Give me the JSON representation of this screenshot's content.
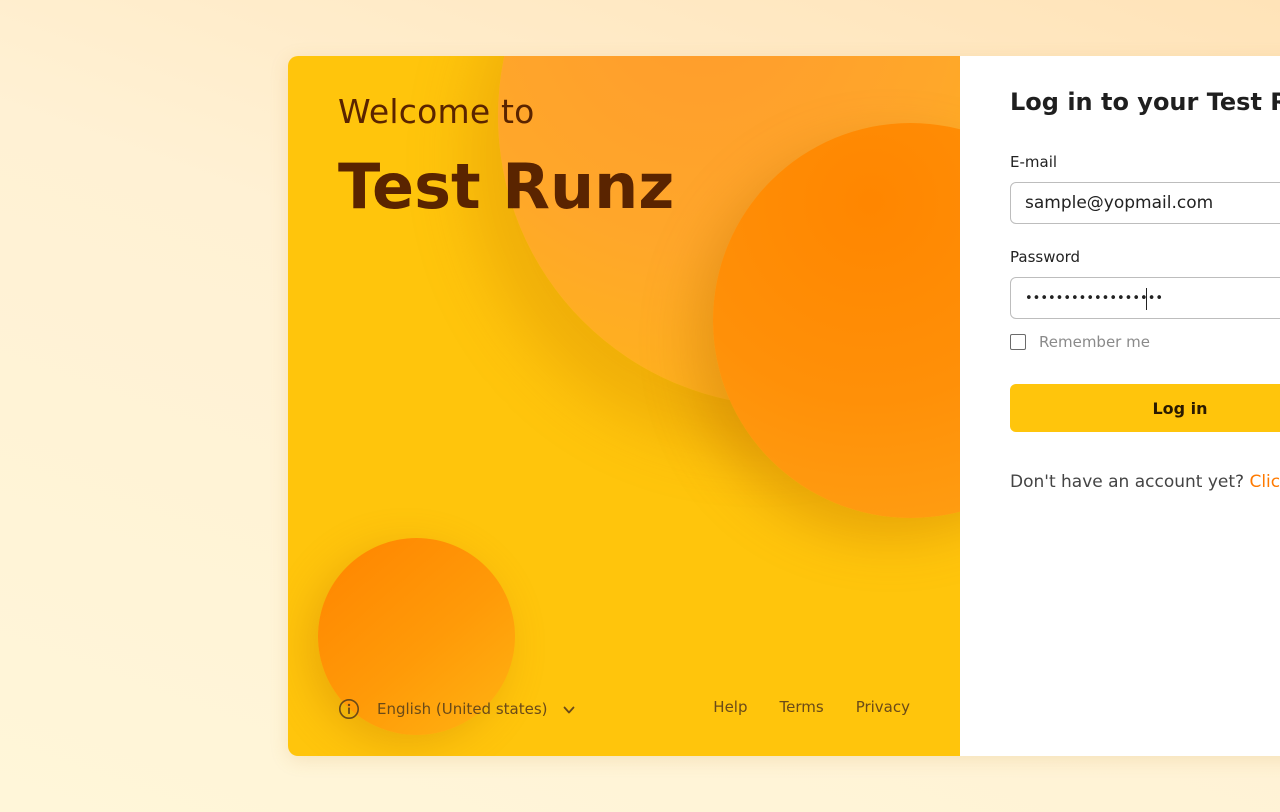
{
  "hero": {
    "welcome": "Welcome to",
    "brand": "Test Runz",
    "colors": {
      "background": "#ffc50c",
      "accent": "#ff8600",
      "text": "#5a2400"
    }
  },
  "footer": {
    "info_icon": "info-icon",
    "language": "English (United states)",
    "dropdown_icon": "chevron-down-icon",
    "links": {
      "help": "Help",
      "terms": "Terms",
      "privacy": "Privacy"
    }
  },
  "login": {
    "title": "Log in to your Test Runz account",
    "email_label": "E-mail",
    "email_value": "sample@yopmail.com",
    "password_label": "Password",
    "password_value": "••••••••••••••••••",
    "remember_label": "Remember me",
    "remember_checked": false,
    "submit_label": "Log in",
    "signup_prompt": "Don't have an account yet? ",
    "signup_link": "Click here",
    "colors": {
      "button": "#ffc50c",
      "link": "#ff7a00"
    }
  }
}
